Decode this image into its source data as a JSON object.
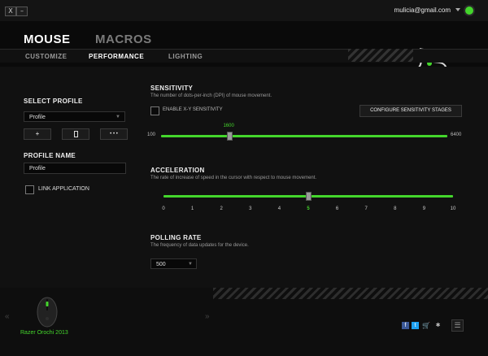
{
  "window": {
    "close_label": "X",
    "minimize_label": "–",
    "email": "mulicia@gmail.com"
  },
  "nav": {
    "main_tabs": [
      {
        "label": "MOUSE",
        "active": true
      },
      {
        "label": "MACROS",
        "active": false
      }
    ],
    "sub_tabs": [
      {
        "label": "CUSTOMIZE",
        "active": false
      },
      {
        "label": "PERFORMANCE",
        "active": true
      },
      {
        "label": "LIGHTING",
        "active": false
      }
    ]
  },
  "profile": {
    "section_label": "SELECT PROFILE",
    "selected": "Profile",
    "add_label": "+",
    "delete_icon": "trash-icon",
    "more_label": "• • •",
    "name_label": "PROFILE NAME",
    "name_value": "Profile",
    "link_label": "LINK APPLICATION"
  },
  "sensitivity": {
    "title": "SENSITIVITY",
    "description": "The number of dots-per-inch (DPI) of mouse movement.",
    "xy_label": "ENABLE X-Y SENSITIVITY",
    "configure_label": "CONFIGURE SENSITIVITY STAGES",
    "min": "100",
    "max": "6400",
    "value": "1600",
    "value_fraction": 0.24
  },
  "acceleration": {
    "title": "ACCELERATION",
    "description": "The rate of increase of speed in the cursor with respect to mouse movement.",
    "ticks": [
      "0",
      "1",
      "2",
      "3",
      "4",
      "5",
      "6",
      "7",
      "8",
      "9",
      "10"
    ],
    "value": 5
  },
  "polling": {
    "title": "POLLING RATE",
    "description": "The frequency of data updates for the device.",
    "value": "500"
  },
  "footer": {
    "device_name": "Razer Orochi 2013",
    "prev_label": "«",
    "next_label": "»",
    "social": [
      "facebook-icon",
      "twitter-icon",
      "cart-icon",
      "razer-icon"
    ]
  },
  "colors": {
    "accent": "#44d62c",
    "background": "#111111"
  }
}
